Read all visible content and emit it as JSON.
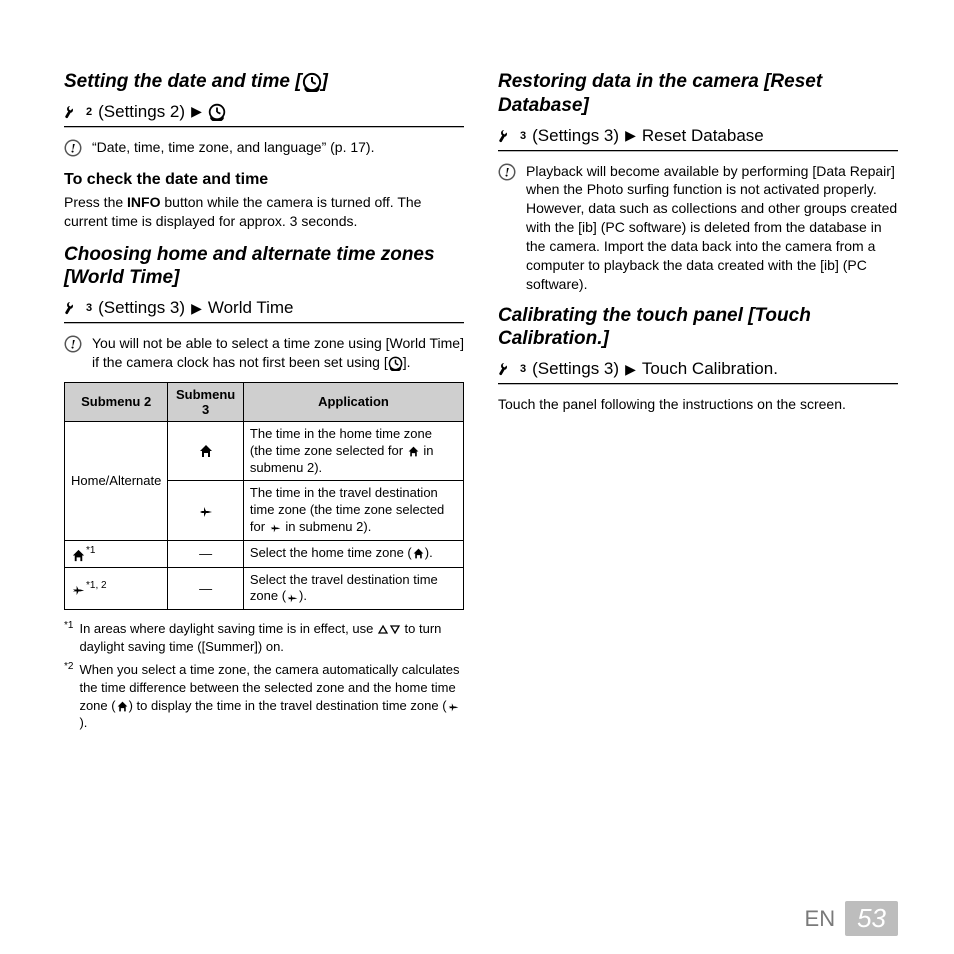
{
  "left": {
    "sec1": {
      "title": "Setting the date and time [",
      "title_suffix": "]",
      "path_label": "(Settings 2)",
      "note": "“Date, time, time zone, and language” (p. 17).",
      "sub_heading": "To check the date and time",
      "body_prefix": "Press the ",
      "body_bold": "INFO",
      "body_suffix": " button while the camera is turned off. The current time is displayed for approx. 3 seconds."
    },
    "sec2": {
      "title": "Choosing home and alternate time zones [World Time]",
      "path_label": "(Settings 3)",
      "path_target": "World Time",
      "note_before": "You will not be able to select a time zone using [World Time] if the camera clock has not first been set using [",
      "note_after": "].",
      "table": {
        "headers": [
          "Submenu 2",
          "Submenu 3",
          "Application"
        ],
        "row1_c1": "Home/Alternate",
        "row1_app_a": "The time in the home time zone (the time zone selected for ",
        "row1_app_a2": " in submenu 2).",
        "row1_app_b": "The time in the travel destination time zone (the time zone selected for ",
        "row1_app_b2": " in submenu 2).",
        "row2_sup": "*1",
        "row2_app_a": "Select the home time zone (",
        "row2_app_a2": ").",
        "row3_sup": "*1, 2",
        "row3_app_a": "Select the travel destination time zone (",
        "row3_app_a2": ").",
        "dash": "—"
      },
      "footnotes": {
        "f1_label": "*1",
        "f1_before": "In areas where daylight saving time is in effect, use ",
        "f1_after": " to turn daylight saving time ([Summer]) on.",
        "f2_label": "*2",
        "f2_before": "When you select a time zone, the camera automatically calculates the time difference between the selected zone and the home time zone (",
        "f2_mid": ") to display the time in the travel destination time zone (",
        "f2_after": ")."
      }
    }
  },
  "right": {
    "sec3": {
      "title": "Restoring data in the camera [Reset Database]",
      "path_label": "(Settings 3)",
      "path_target": "Reset Database",
      "note": "Playback will become available by performing [Data Repair] when the Photo surfing function is not activated properly. However, data such as collections and other groups created with the [ib] (PC software) is deleted from the database in the camera. Import the data back into the camera from a computer to playback the data created with the [ib] (PC software)."
    },
    "sec4": {
      "title": "Calibrating the touch panel [Touch Calibration.]",
      "path_label": "(Settings 3)",
      "path_target": "Touch Calibration.",
      "body": "Touch the panel following the instructions on the screen."
    }
  },
  "footer": {
    "lang": "EN",
    "page": "53"
  }
}
